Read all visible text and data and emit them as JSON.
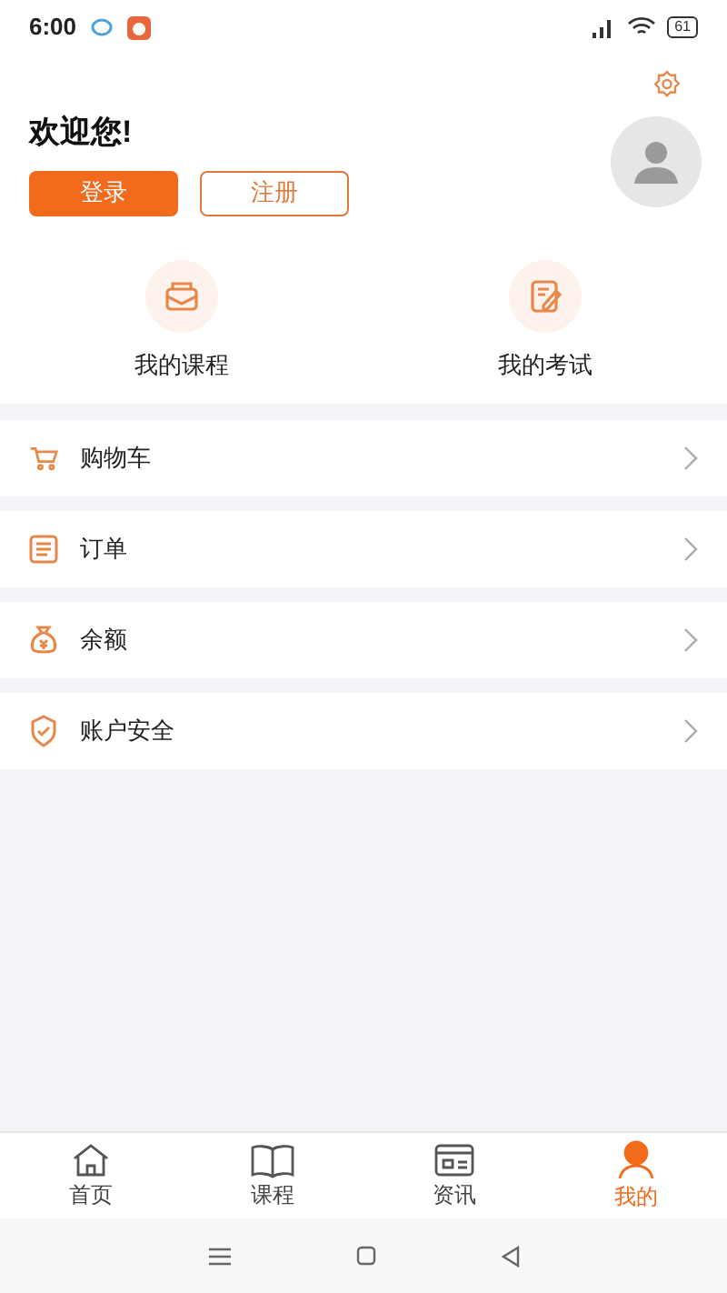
{
  "status_bar": {
    "time": "6:00",
    "battery": "61"
  },
  "header": {
    "greeting": "欢迎您!",
    "buttons": [
      {
        "kind": "primary",
        "label": "登录"
      },
      {
        "kind": "outline",
        "label": "注册"
      }
    ]
  },
  "shortcuts": [
    {
      "kind": "course",
      "label": "我的课程"
    },
    {
      "kind": "exam",
      "label": "我的考试"
    }
  ],
  "menu": [
    {
      "kind": "cart",
      "label": "购物车"
    },
    {
      "kind": "order",
      "label": "订单"
    },
    {
      "kind": "balance",
      "label": "余额"
    },
    {
      "kind": "security",
      "label": "账户安全"
    }
  ],
  "tab_bar": [
    {
      "kind": "home",
      "label": "首页",
      "selected": false
    },
    {
      "kind": "course",
      "label": "课程",
      "selected": false
    },
    {
      "kind": "news",
      "label": "资讯",
      "selected": false
    },
    {
      "kind": "me",
      "label": "我的",
      "selected": true
    }
  ]
}
